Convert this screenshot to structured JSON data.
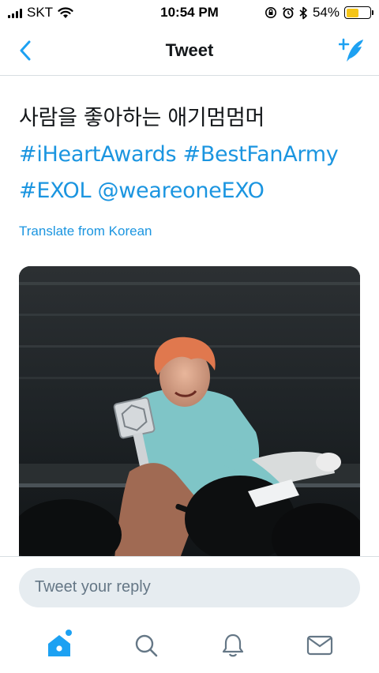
{
  "status_bar": {
    "carrier": "SKT",
    "time": "10:54 PM",
    "battery_percent": "54%",
    "battery_level": 0.54,
    "battery_color": "#f5c518"
  },
  "nav": {
    "back_icon": "chevron-left-icon",
    "title": "Tweet",
    "compose_icon": "compose-tweet-icon"
  },
  "tweet": {
    "text_line1": "사람을 좋아하는 애기멈멈머",
    "hashtag1": "#iHeartAwards",
    "hashtag2": "#BestFanArmy",
    "hashtag3": "#EXOL",
    "mention": "@weareoneEXO",
    "translate_label": "Translate from Korean",
    "media_description": "gif"
  },
  "reply": {
    "placeholder": "Tweet your reply"
  },
  "tabs": [
    {
      "name": "home",
      "icon": "home-icon"
    },
    {
      "name": "search",
      "icon": "search-icon"
    },
    {
      "name": "notifications",
      "icon": "bell-icon"
    },
    {
      "name": "messages",
      "icon": "envelope-icon"
    }
  ],
  "colors": {
    "accent": "#1da1f2",
    "link": "#1b95e0",
    "text": "#14171a",
    "reply_bg": "#e6ecf0"
  }
}
